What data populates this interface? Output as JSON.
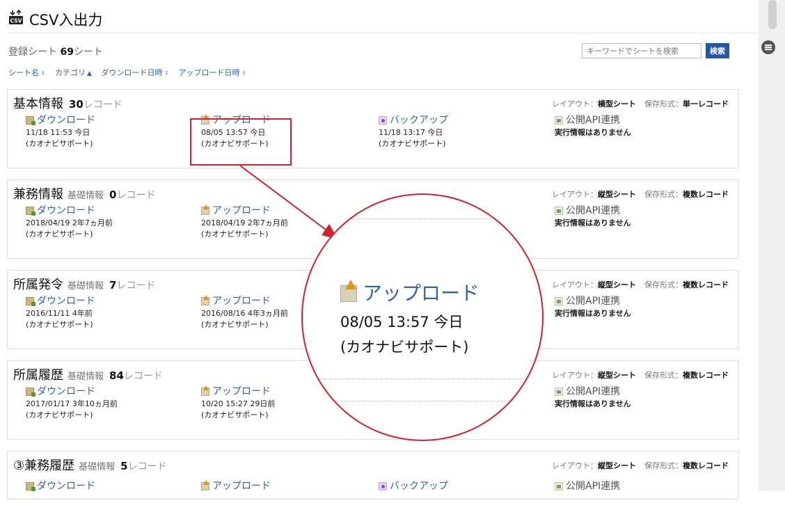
{
  "header": {
    "title": "CSV入出力",
    "icon": "csv-icon"
  },
  "summary": {
    "label": "登録シート",
    "count": "69",
    "unit": "シート"
  },
  "search": {
    "placeholder": "キーワードでシートを検索",
    "button_label": "検索"
  },
  "sort": [
    {
      "label": "シート名",
      "arrow": "⬍"
    },
    {
      "label": "カテゴリ",
      "arrow": "▲"
    },
    {
      "label": "ダウンロード日時",
      "arrow": "⬍"
    },
    {
      "label": "アップロード日時",
      "arrow": "⬍"
    }
  ],
  "meta_labels": {
    "layout": "レイアウト：",
    "format": "保存形式："
  },
  "actions": {
    "download": "ダウンロード",
    "upload": "アップロード",
    "backup": "バックアップ",
    "api": "公開API連携",
    "no_info": "実行情報はありません"
  },
  "sheets": [
    {
      "name": "基本情報",
      "category": "",
      "records": "30",
      "records_unit": "レコード",
      "layout": "横型シート",
      "format": "単一レコード",
      "download": {
        "date": "11/18 11:53 今日",
        "user": "(カオナビサポート)"
      },
      "upload": {
        "date": "08/05 13:57 今日",
        "user": "(カオナビサポート)"
      },
      "backup": {
        "date": "11/18 13:17 今日",
        "user": "(カオナビサポート)"
      }
    },
    {
      "name": "兼務情報",
      "category": "基礎情報",
      "records": "0",
      "records_unit": "レコード",
      "layout": "縦型シート",
      "format": "複数レコード",
      "download": {
        "date": "2018/04/19 2年7ヵ月前",
        "user": "(カオナビサポート)"
      },
      "upload": {
        "date": "2018/04/19 2年7ヵ月前",
        "user": "(カオナビサポート)"
      }
    },
    {
      "name": "所属発令",
      "category": "基礎情報",
      "records": "7",
      "records_unit": "レコード",
      "layout": "縦型シート",
      "format": "複数レコード",
      "download": {
        "date": "2016/11/11 4年前",
        "user": "(カオナビサポート)"
      },
      "upload": {
        "date": "2016/08/16 4年3ヵ月前",
        "user": "(カオナビサポート)"
      }
    },
    {
      "name": "所属履歴",
      "category": "基礎情報",
      "records": "84",
      "records_unit": "レコード",
      "layout": "縦型シート",
      "format": "複数レコード",
      "download": {
        "date": "2017/01/17 3年10ヵ月前",
        "user": "(カオナビサポート)"
      },
      "upload": {
        "date": "10/20 15:27 29日前",
        "user": "(カオナビサポート)"
      }
    },
    {
      "name": "③兼務履歴",
      "category": "基礎情報",
      "records": "5",
      "records_unit": "レコード",
      "layout": "縦型シート",
      "format": "複数レコード"
    }
  ],
  "zoom": {
    "label": "アップロード",
    "date": "08/05 13:57 今日",
    "user": "(カオナビサポート)"
  },
  "colors": {
    "accent": "#2d62b6",
    "highlight": "#d4202c",
    "search_button": "#2557a7"
  }
}
